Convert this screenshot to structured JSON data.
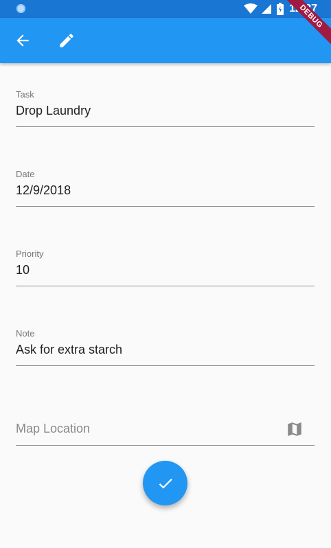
{
  "status_bar": {
    "time": "12:37"
  },
  "debug_banner": {
    "text": "DEBUG"
  },
  "app_bar": {
    "back_icon": "arrow-back-icon",
    "edit_icon": "edit-pencil-icon"
  },
  "form": {
    "task": {
      "label": "Task",
      "value": "Drop Laundry"
    },
    "date": {
      "label": "Date",
      "value": "12/9/2018"
    },
    "priority": {
      "label": "Priority",
      "value": "10"
    },
    "note": {
      "label": "Note",
      "value": "Ask for extra starch"
    },
    "map_location": {
      "placeholder": "Map Location",
      "icon": "map-icon"
    }
  },
  "fab": {
    "icon": "check-icon"
  },
  "colors": {
    "status_bar": "#1976d2",
    "app_bar": "#2196f3",
    "accent": "#2196f3",
    "background": "#fafafa"
  }
}
